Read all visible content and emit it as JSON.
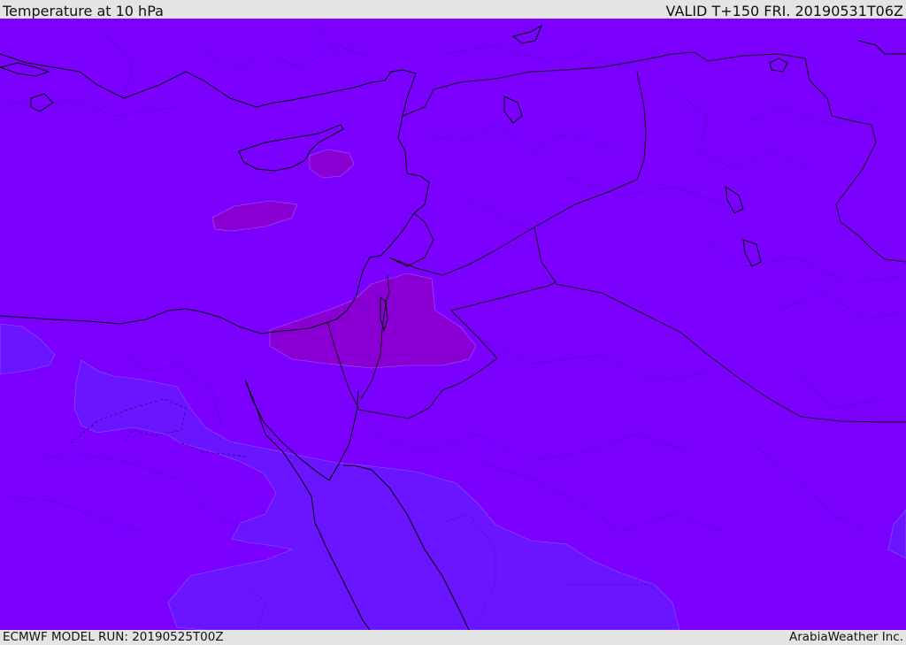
{
  "header": {
    "title": "Temperature at 10 hPa",
    "valid": "VALID T+150 FRI. 20190531T06Z"
  },
  "footer": {
    "model_run": "ECMWF MODEL RUN: 20190525T00Z",
    "credit": "ArabiaWeather Inc."
  },
  "map": {
    "field": "Temperature at 10 hPa",
    "colors": {
      "base": "#7b00ff",
      "warm_patch": "#8200dc",
      "cool_patch": "#6a14ff",
      "coastline": "#000000",
      "border": "#222222"
    }
  }
}
